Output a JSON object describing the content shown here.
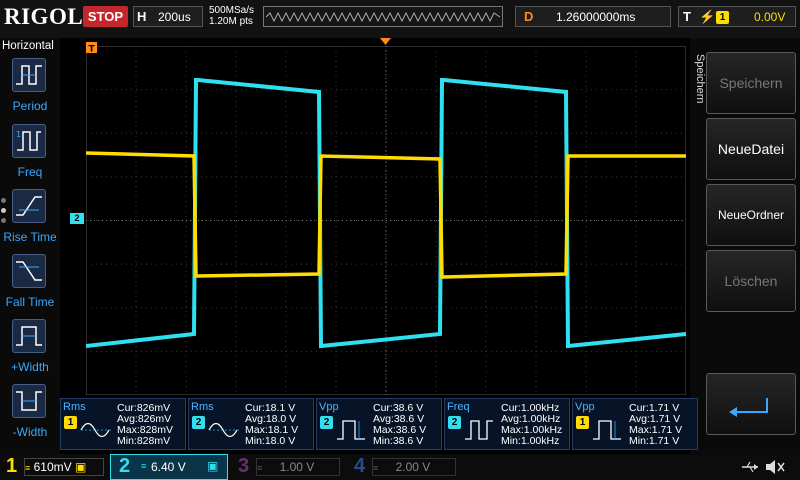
{
  "header": {
    "logo": "RIGOL",
    "run_state": "STOP",
    "timebase_letter": "H",
    "timebase": "200us",
    "sample_rate": "500MSa/s",
    "memory_depth": "1.20M pts",
    "delay_letter": "D",
    "delay": "1.26000000ms",
    "trigger_letter": "T",
    "trigger_source": "1",
    "trigger_level": "0.00V"
  },
  "left_panel": {
    "title": "Horizontal",
    "items": [
      {
        "label": "Period",
        "icon": "period-icon"
      },
      {
        "label": "Freq",
        "icon": "frequency-icon"
      },
      {
        "label": "Rise Time",
        "icon": "rise-time-icon"
      },
      {
        "label": "Fall Time",
        "icon": "fall-time-icon"
      },
      {
        "label": "+Width",
        "icon": "positive-width-icon"
      },
      {
        "label": "-Width",
        "icon": "negative-width-icon"
      }
    ]
  },
  "right_panel": {
    "title": "Speichern",
    "buttons": [
      {
        "label": "Speichern",
        "enabled": false
      },
      {
        "label": "NeueDatei",
        "enabled": true
      },
      {
        "label": "NeueOrdner",
        "enabled": true
      },
      {
        "label": "Löschen",
        "enabled": false
      }
    ],
    "return_icon": "return-arrow-icon"
  },
  "markers": {
    "trigger_pos": "T",
    "ch2_marker": "2",
    "trigger_level_marker": "T"
  },
  "measurements": [
    {
      "name": "Rms",
      "channel": "1",
      "icon": "sine-wave-icon",
      "cur": "Cur:826mV",
      "avg": "Avg:826mV",
      "max": "Max:828mV",
      "min": "Min:828mV"
    },
    {
      "name": "Rms",
      "channel": "2",
      "icon": "sine-wave-icon",
      "cur": "Cur:18.1 V",
      "avg": "Avg:18.0 V",
      "max": "Max:18.1 V",
      "min": "Min:18.0 V"
    },
    {
      "name": "Vpp",
      "channel": "2",
      "icon": "square-pulse-icon",
      "cur": "Cur:38.6 V",
      "avg": "Avg:38.6 V",
      "max": "Max:38.6 V",
      "min": "Min:38.6 V"
    },
    {
      "name": "Freq",
      "channel": "2",
      "icon": "square-pulse-icon",
      "cur": "Cur:1.00kHz",
      "avg": "Avg:1.00kHz",
      "max": "Max:1.00kHz",
      "min": "Min:1.00kHz"
    },
    {
      "name": "Vpp",
      "channel": "1",
      "icon": "square-pulse-icon",
      "cur": "Cur:1.71 V",
      "avg": "Avg:1.71 V",
      "max": "Max:1.71 V",
      "min": "Min:1.71 V"
    }
  ],
  "channels": [
    {
      "num": "1",
      "scale": "610mV",
      "color": "#ffdd00",
      "active": true
    },
    {
      "num": "2",
      "scale": "6.40 V",
      "color": "#00d8f0",
      "active": true
    },
    {
      "num": "3",
      "scale": "1.00 V",
      "color": "#d046e0",
      "active": false
    },
    {
      "num": "4",
      "scale": "2.00 V",
      "color": "#3b7cff",
      "active": false
    }
  ],
  "status_icons": [
    "usb-icon",
    "mute-icon"
  ],
  "colors": {
    "ch1": "#ffdd00",
    "ch2": "#2ee0f0",
    "stop": "#c5262b",
    "delay_marker": "#ff8c1a",
    "menu_text": "#3aa8ff"
  }
}
